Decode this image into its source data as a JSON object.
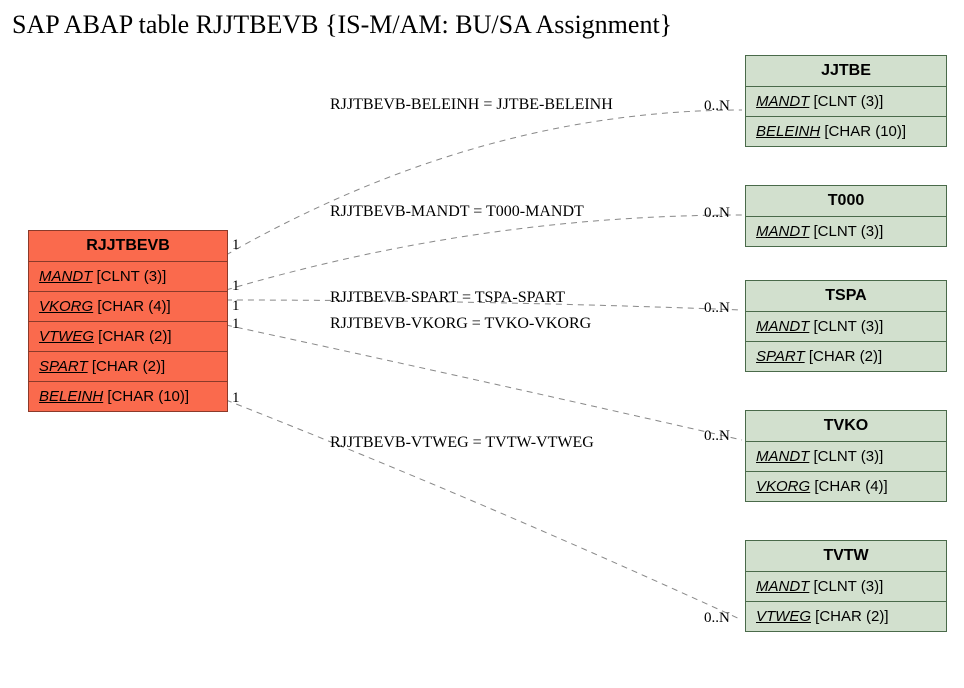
{
  "title": "SAP ABAP table RJJTBEVB {IS-M/AM: BU/SA Assignment}",
  "main_entity": {
    "name": "RJJTBEVB",
    "fields": [
      {
        "name": "MANDT",
        "type": "[CLNT (3)]"
      },
      {
        "name": "VKORG",
        "type": "[CHAR (4)]"
      },
      {
        "name": "VTWEG",
        "type": "[CHAR (2)]"
      },
      {
        "name": "SPART",
        "type": "[CHAR (2)]"
      },
      {
        "name": "BELEINH",
        "type": "[CHAR (10)]"
      }
    ]
  },
  "related_entities": [
    {
      "name": "JJTBE",
      "fields": [
        {
          "name": "MANDT",
          "type": "[CLNT (3)]"
        },
        {
          "name": "BELEINH",
          "type": "[CHAR (10)]"
        }
      ]
    },
    {
      "name": "T000",
      "fields": [
        {
          "name": "MANDT",
          "type": "[CLNT (3)]"
        }
      ]
    },
    {
      "name": "TSPA",
      "fields": [
        {
          "name": "MANDT",
          "type": "[CLNT (3)]"
        },
        {
          "name": "SPART",
          "type": "[CHAR (2)]"
        }
      ]
    },
    {
      "name": "TVKO",
      "fields": [
        {
          "name": "MANDT",
          "type": "[CLNT (3)]"
        },
        {
          "name": "VKORG",
          "type": "[CHAR (4)]"
        }
      ]
    },
    {
      "name": "TVTW",
      "fields": [
        {
          "name": "MANDT",
          "type": "[CLNT (3)]"
        },
        {
          "name": "VTWEG",
          "type": "[CHAR (2)]"
        }
      ]
    }
  ],
  "relations": [
    {
      "label": "RJJTBEVB-BELEINH = JJTBE-BELEINH",
      "left_card": "1",
      "right_card": "0..N"
    },
    {
      "label": "RJJTBEVB-MANDT = T000-MANDT",
      "left_card": "1",
      "right_card": "0..N"
    },
    {
      "label": "RJJTBEVB-SPART = TSPA-SPART",
      "left_card": "1",
      "right_card": "0..N"
    },
    {
      "label": "RJJTBEVB-VKORG = TVKO-VKORG",
      "left_card": "1",
      "right_card": "0..N"
    },
    {
      "label": "RJJTBEVB-VTWEG = TVTW-VTWEG",
      "left_card": "1",
      "right_card": "0..N"
    }
  ]
}
